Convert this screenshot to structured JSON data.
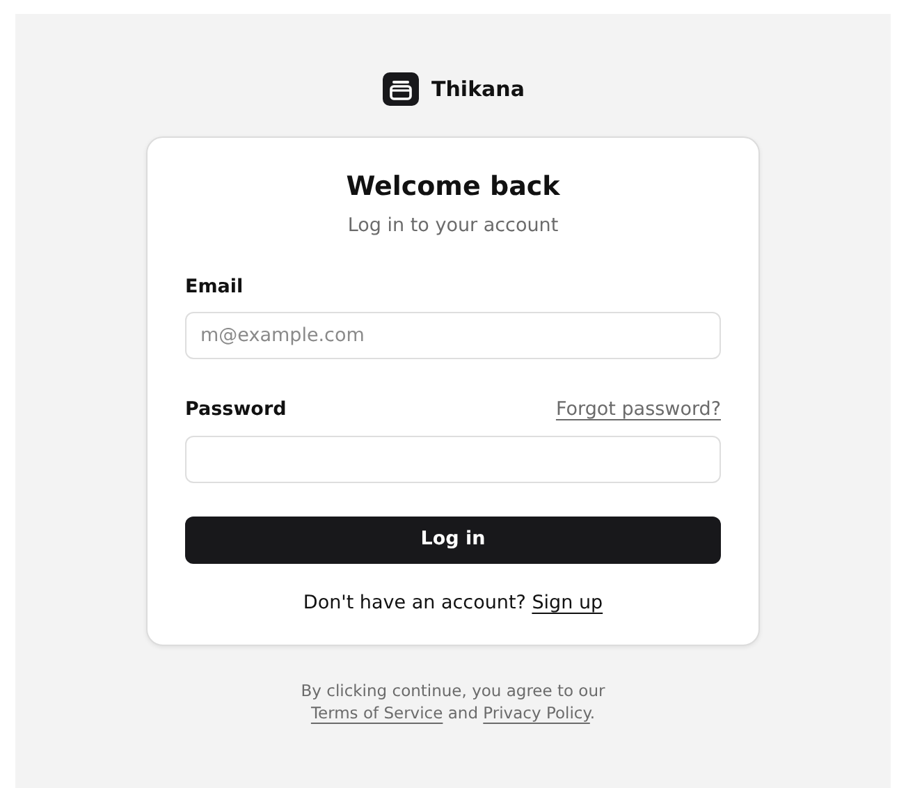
{
  "brand": {
    "name": "Thikana"
  },
  "card": {
    "title": "Welcome back",
    "subtitle": "Log in to your account",
    "fields": [
      {
        "label": "Email",
        "placeholder": "m@example.com"
      },
      {
        "label": "Password",
        "link": "Forgot password?"
      }
    ],
    "submit": "Log in",
    "signup": {
      "text": "Don't have an account?",
      "link": "Sign up"
    }
  },
  "footer": {
    "text_1": "By clicking continue, you agree to our",
    "link_1": "Terms of Service",
    "text_2": "and",
    "link_2": "Privacy Policy",
    "text_3": "."
  }
}
